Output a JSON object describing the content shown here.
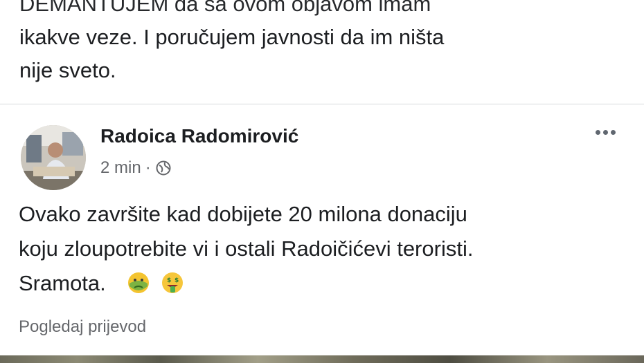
{
  "preceding_post": {
    "lines": [
      "DEMANTUJEM da sa ovom objavom imam",
      "ikakve veze. I poručujem javnosti da im ništa",
      "nije sveto."
    ]
  },
  "post": {
    "author": "Radoica Radomirović",
    "time": "2 min",
    "separator": "·",
    "privacy_icon": "globe-icon",
    "more_icon": "more-options-icon",
    "text_lines": [
      "Ovako završite kad dobijete 20 milona donaciju",
      "koju zloupotrebite vi i ostali Radoičićevi teroristi.",
      "Sramota."
    ],
    "emojis": [
      "nauseated-face-icon",
      "money-mouth-face-icon"
    ],
    "translate_link": "Pogledaj prijevod"
  },
  "colors": {
    "text": "#1c1e21",
    "secondary_text": "#65676b",
    "divider": "#d7d9dc"
  }
}
